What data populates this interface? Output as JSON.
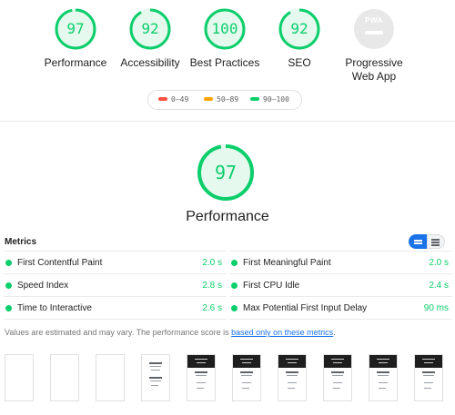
{
  "colors": {
    "pass": "#0cce6b",
    "average": "#ffa400",
    "fail": "#ff4e42",
    "accent": "#1a73e8"
  },
  "categories": [
    {
      "id": "performance",
      "score": 97,
      "label": "Performance"
    },
    {
      "id": "accessibility",
      "score": 92,
      "label": "Accessibility"
    },
    {
      "id": "best-practices",
      "score": 100,
      "label": "Best Practices"
    },
    {
      "id": "seo",
      "score": 92,
      "label": "SEO"
    }
  ],
  "pwa": {
    "badge": "PWA",
    "label_line1": "Progressive",
    "label_line2": "Web App"
  },
  "legend": {
    "fail": "0–49",
    "average": "50–89",
    "pass": "90–100"
  },
  "performance": {
    "score": 97,
    "title": "Performance"
  },
  "metrics": {
    "title": "Metrics",
    "left": [
      {
        "name": "First Contentful Paint",
        "value": "2.0 s"
      },
      {
        "name": "Speed Index",
        "value": "2.8 s"
      },
      {
        "name": "Time to Interactive",
        "value": "2.6 s"
      }
    ],
    "right": [
      {
        "name": "First Meaningful Paint",
        "value": "2.0 s"
      },
      {
        "name": "First CPU Idle",
        "value": "2.4 s"
      },
      {
        "name": "Max Potential First Input Delay",
        "value": "90 ms"
      }
    ]
  },
  "note": {
    "text": "Values are estimated and may vary. The performance score is ",
    "link": "based only on these metrics",
    "suffix": "."
  }
}
